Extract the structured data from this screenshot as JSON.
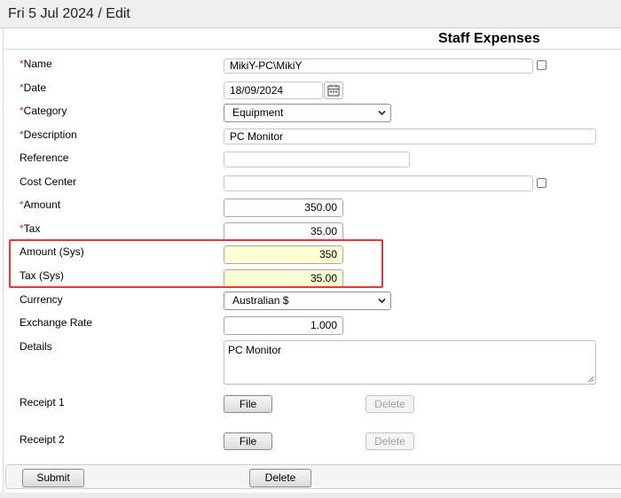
{
  "header": {
    "title": "Fri 5 Jul 2024 / Edit"
  },
  "form": {
    "title": "Staff Expenses",
    "required_marker": "*",
    "fields": {
      "name": {
        "label": "Name",
        "value": "MikiY-PC\\MikiY"
      },
      "date": {
        "label": "Date",
        "value": "18/09/2024"
      },
      "category": {
        "label": "Category",
        "value": "Equipment"
      },
      "description": {
        "label": "Description",
        "value": "PC Monitor"
      },
      "reference": {
        "label": "Reference",
        "value": ""
      },
      "cost_center": {
        "label": "Cost Center",
        "value": ""
      },
      "amount": {
        "label": "Amount",
        "value": "350.00"
      },
      "tax": {
        "label": "Tax",
        "value": "35.00"
      },
      "amount_sys": {
        "label": "Amount (Sys)",
        "value": "350"
      },
      "tax_sys": {
        "label": "Tax (Sys)",
        "value": "35.00"
      },
      "currency": {
        "label": "Currency",
        "value": "Australian $"
      },
      "exchange_rate": {
        "label": "Exchange Rate",
        "value": "1.000"
      },
      "details": {
        "label": "Details",
        "value": "PC Monitor"
      },
      "receipt1": {
        "label": "Receipt 1",
        "file_label": "File",
        "delete_label": "Delete"
      },
      "receipt2": {
        "label": "Receipt 2",
        "file_label": "File",
        "delete_label": "Delete"
      }
    }
  },
  "footer": {
    "submit_label": "Submit",
    "delete_label": "Delete"
  },
  "colors": {
    "required": "#e02020",
    "sys_field_bg": "#ffffd6",
    "highlight_border": "#e53935"
  },
  "icons": {
    "date_picker": "calendar-icon",
    "dropdown": "chevron-down-icon"
  }
}
